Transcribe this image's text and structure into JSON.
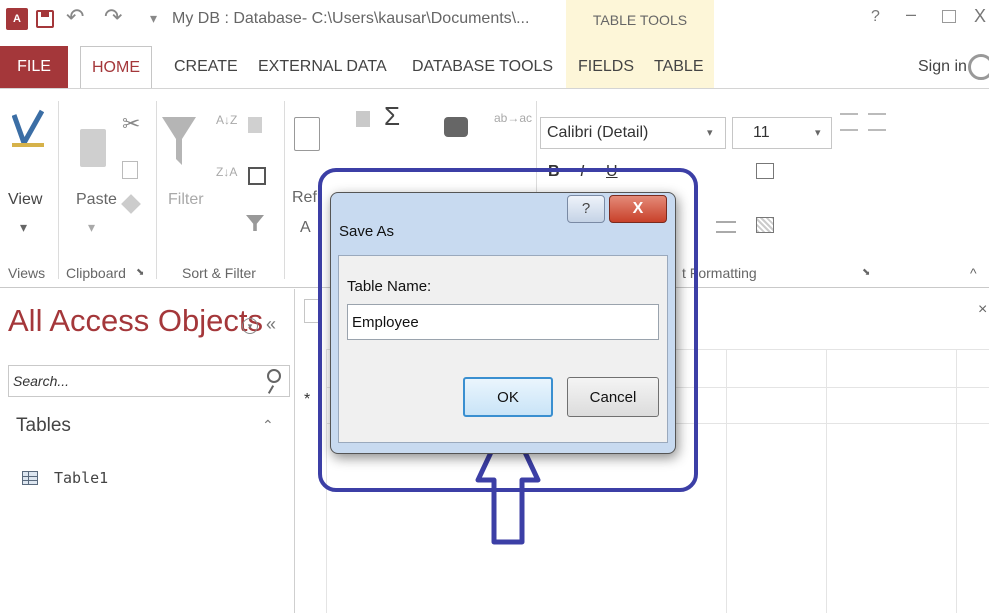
{
  "titlebar": {
    "app_icon": "A",
    "title": "My DB : Database- C:\\Users\\kausar\\Documents\\...",
    "context_group": "TABLE TOOLS",
    "help": "?",
    "minimize": "–",
    "close": "X",
    "undo_glyph": "↶",
    "redo_glyph": "↷",
    "qat_more": "▾"
  },
  "tabs": {
    "file": "FILE",
    "home": "HOME",
    "create": "CREATE",
    "external_data": "EXTERNAL DATA",
    "database_tools": "DATABASE TOOLS",
    "fields": "FIELDS",
    "table": "TABLE",
    "sign_in": "Sign in"
  },
  "ribbon": {
    "view": "View",
    "paste": "Paste",
    "filter": "Filter",
    "refresh": "Refr",
    "refresh_line2": "A",
    "font_name": "Calibri (Detail)",
    "font_size": "11",
    "groups": {
      "views": "Views",
      "clipboard": "Clipboard",
      "sort_filter": "Sort & Filter",
      "text_formatting": "t Formatting"
    },
    "glyphs": {
      "sigma": "Σ",
      "bold": "B",
      "italic": "I",
      "underline": "U",
      "scissors": "✂",
      "collapse": "^",
      "dropdown": "▾",
      "launcher": "⬊",
      "sort_az": "A↓Z",
      "sort_za": "Z↓A",
      "replace": "ab→ac"
    }
  },
  "nav": {
    "title": "All Access Objects",
    "dropdown_glyph": "▾",
    "collapse_glyph": "«",
    "search_placeholder": "Search...",
    "section": "Tables",
    "section_collapse": "⌃",
    "items": [
      {
        "label": "Table1"
      }
    ]
  },
  "datasheet": {
    "close": "×",
    "new_row_marker": "*"
  },
  "dialog": {
    "title": "Save As",
    "help": "?",
    "close": "X",
    "field_label": "Table Name:",
    "table_name_value": "Employee",
    "ok": "OK",
    "cancel": "Cancel"
  },
  "colors": {
    "accent": "#a4373a",
    "annotation": "#3c3fa6",
    "context_tab_bg": "#fdf6d8"
  }
}
